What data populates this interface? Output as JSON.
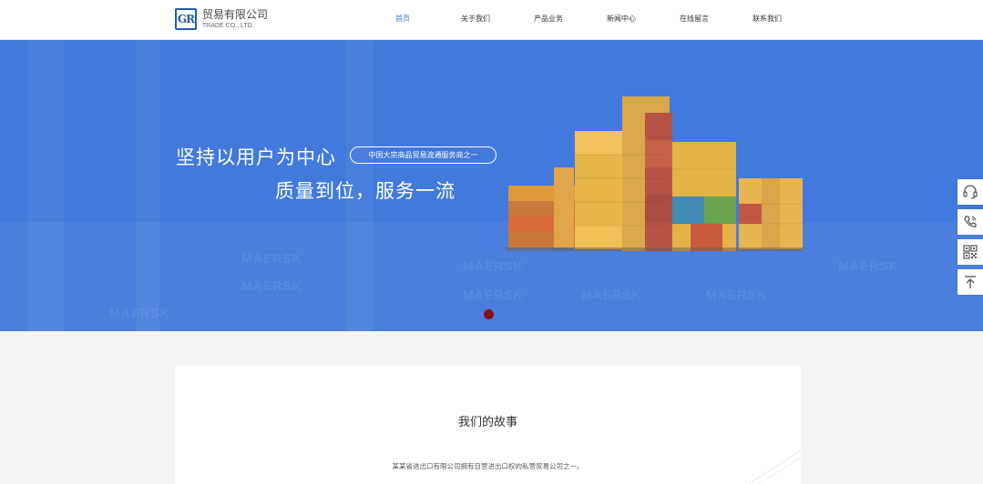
{
  "header": {
    "logo_mark": "GR",
    "logo_title": "贸易有限公司",
    "logo_sub": "TRADE CO., LTD.",
    "nav": [
      {
        "label": "首页",
        "active": true
      },
      {
        "label": "关于我们",
        "active": false
      },
      {
        "label": "产品业务",
        "active": false
      },
      {
        "label": "新闻中心",
        "active": false
      },
      {
        "label": "在线留言",
        "active": false
      },
      {
        "label": "联系我们",
        "active": false
      }
    ]
  },
  "banner": {
    "line1": "坚持以用户为中心",
    "pill": "中国大宗商品贸易流通服务商之一",
    "line2": "质量到位，服务一流",
    "background_color": "#4179dc",
    "dot_color": "#8b0d15",
    "watermark_text": "MAERSK"
  },
  "side_tools": [
    {
      "icon": "customer-service-icon"
    },
    {
      "icon": "phone-icon"
    },
    {
      "icon": "qr-code-icon"
    },
    {
      "icon": "back-to-top-icon"
    }
  ],
  "story": {
    "title": "我们的故事",
    "text": "某某省进出口有限公司拥有自营进出口权的私营贸易公司之一。"
  }
}
